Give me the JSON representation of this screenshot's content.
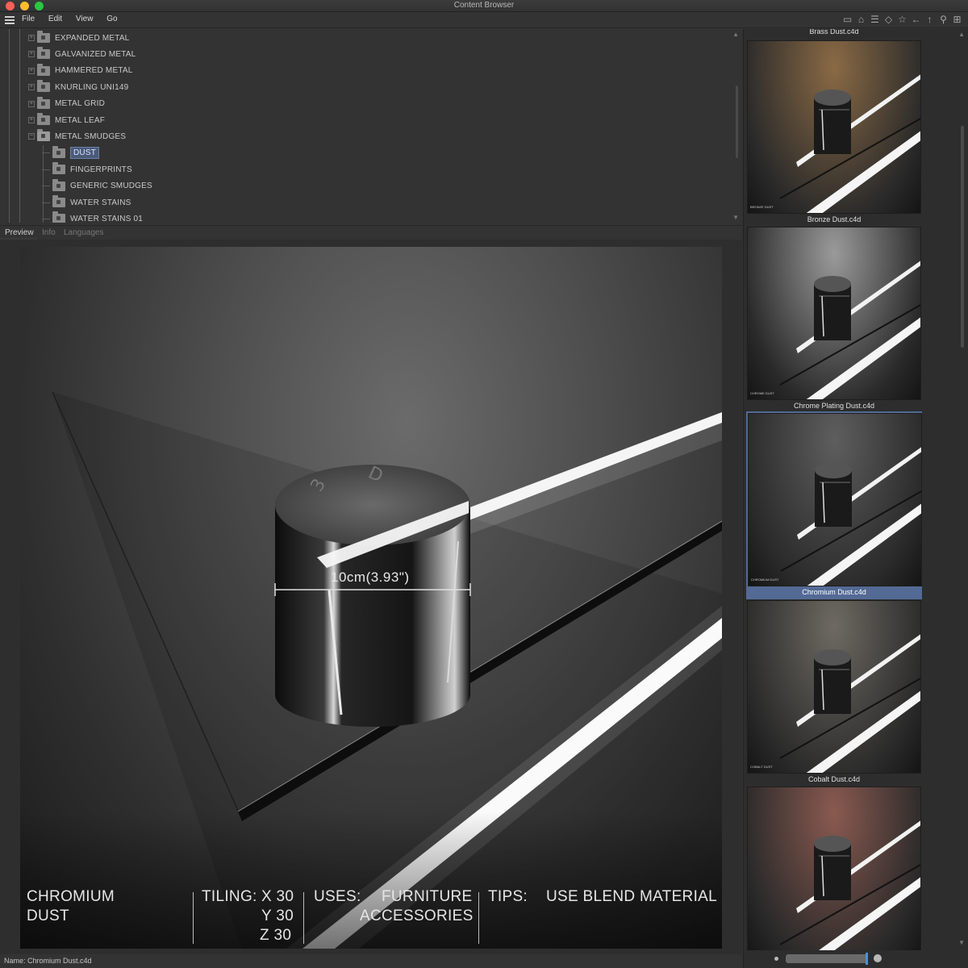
{
  "window": {
    "title": "Content Browser"
  },
  "menu": {
    "items": [
      "File",
      "Edit",
      "View",
      "Go"
    ]
  },
  "toolbar_icons": [
    "layout-icon",
    "home-icon",
    "filter-icon",
    "cube-icon",
    "star-icon",
    "back-icon",
    "up-icon",
    "search-icon",
    "new-window-icon"
  ],
  "tree": {
    "items": [
      {
        "label": "EXPANDED METAL",
        "depth": 1,
        "expandable": true,
        "open": false
      },
      {
        "label": "GALVANIZED METAL",
        "depth": 1,
        "expandable": true,
        "open": false
      },
      {
        "label": "HAMMERED METAL",
        "depth": 1,
        "expandable": true,
        "open": false
      },
      {
        "label": "KNURLING UNI149",
        "depth": 1,
        "expandable": true,
        "open": false
      },
      {
        "label": "METAL GRID",
        "depth": 1,
        "expandable": true,
        "open": false
      },
      {
        "label": "METAL LEAF",
        "depth": 1,
        "expandable": true,
        "open": false
      },
      {
        "label": "METAL SMUDGES",
        "depth": 1,
        "expandable": true,
        "open": true
      },
      {
        "label": "DUST",
        "depth": 2,
        "expandable": false,
        "open": false,
        "selected": true
      },
      {
        "label": "FINGERPRINTS",
        "depth": 2,
        "expandable": false,
        "open": false
      },
      {
        "label": "GENERIC SMUDGES",
        "depth": 2,
        "expandable": false,
        "open": false
      },
      {
        "label": "WATER STAINS",
        "depth": 2,
        "expandable": false,
        "open": false
      },
      {
        "label": "WATER STAINS 01",
        "depth": 2,
        "expandable": false,
        "open": false
      }
    ]
  },
  "tabs": {
    "preview": "Preview",
    "info": "Info",
    "languages": "Languages"
  },
  "preview": {
    "dimension_label": "10cm(3.93\")",
    "overlay": {
      "name_line1": "CHROMIUM",
      "name_line2": "DUST",
      "tiling_label": "TILING:",
      "tiling_x": "X 30",
      "tiling_y": "Y 30",
      "tiling_z": "Z 30",
      "uses_label": "USES:",
      "uses_line1": "FURNITURE",
      "uses_line2": "ACCESSORIES",
      "tips_label": "TIPS:",
      "tips_value": "USE BLEND MATERIAL"
    }
  },
  "status": {
    "name_text": "Name:  Chromium Dust.c4d"
  },
  "thumbnails": {
    "top_partial": "Brass Dust.c4d",
    "items": [
      {
        "caption": "Bronze Dust.c4d",
        "tone": "#8a6a45",
        "selected": false,
        "small_name": "BRONZE DUST"
      },
      {
        "caption": "Chrome Plating Dust.c4d",
        "tone": "#9a9a9a",
        "selected": false,
        "small_name": "CHROME DUST"
      },
      {
        "caption": "Chromium Dust.c4d",
        "tone": "#5e5e5e",
        "selected": true,
        "small_name": "CHROMIUM DUST"
      },
      {
        "caption": "Cobalt Dust.c4d",
        "tone": "#6e6a62",
        "selected": false,
        "small_name": "COBALT DUST"
      },
      {
        "caption": "",
        "tone": "#8a5a50",
        "selected": false,
        "small_name": ""
      }
    ]
  }
}
